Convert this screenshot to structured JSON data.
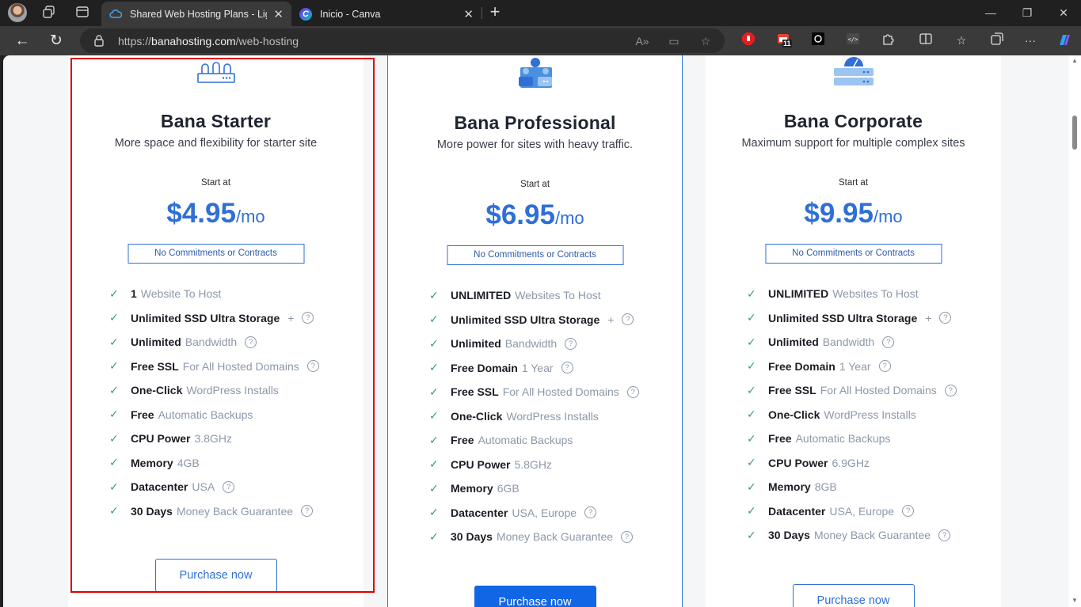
{
  "browser": {
    "tabs": [
      {
        "title": "Shared Web Hosting Plans - Lightning Fast",
        "active": true
      },
      {
        "title": "Inicio - Canva",
        "active": false
      }
    ],
    "url_prefix": "https://",
    "url_host": "banahosting.com",
    "url_path": "/web-hosting",
    "ext_badge": "11"
  },
  "plans": [
    {
      "name": "Bana Starter",
      "desc": "More space and flexibility for starter site",
      "start_label": "Start at",
      "price": "$4.95",
      "per": "/mo",
      "commit": "No Commitments or Contracts",
      "button": "Purchase now",
      "features": [
        {
          "bold": "1",
          "light": "Website To Host",
          "help": false
        },
        {
          "bold": "Unlimited SSD Ultra Storage",
          "light": "+",
          "help": true
        },
        {
          "bold": "Unlimited",
          "light": "Bandwidth",
          "help": true
        },
        {
          "bold": "Free SSL",
          "light": "For All Hosted Domains",
          "help": true
        },
        {
          "bold": "One-Click",
          "light": "WordPress Installs",
          "help": false
        },
        {
          "bold": "Free",
          "light": "Automatic Backups",
          "help": false
        },
        {
          "bold": "CPU Power",
          "light": "3.8GHz",
          "help": false
        },
        {
          "bold": "Memory",
          "light": "4GB",
          "help": false
        },
        {
          "bold": "Datacenter",
          "light": "USA",
          "help": true
        },
        {
          "bold": "30 Days",
          "light": "Money Back Guarantee",
          "help": true
        }
      ]
    },
    {
      "name": "Bana Professional",
      "desc": "More power for sites with heavy traffic.",
      "start_label": "Start at",
      "price": "$6.95",
      "per": "/mo",
      "commit": "No Commitments or Contracts",
      "button": "Purchase now",
      "features": [
        {
          "bold": "UNLIMITED",
          "light": "Websites To Host",
          "help": false
        },
        {
          "bold": "Unlimited SSD Ultra Storage",
          "light": "+",
          "help": true
        },
        {
          "bold": "Unlimited",
          "light": "Bandwidth",
          "help": true
        },
        {
          "bold": "Free Domain",
          "light": "1 Year",
          "help": true
        },
        {
          "bold": "Free SSL",
          "light": "For All Hosted Domains",
          "help": true
        },
        {
          "bold": "One-Click",
          "light": "WordPress Installs",
          "help": false
        },
        {
          "bold": "Free",
          "light": "Automatic Backups",
          "help": false
        },
        {
          "bold": "CPU Power",
          "light": "5.8GHz",
          "help": false
        },
        {
          "bold": "Memory",
          "light": "6GB",
          "help": false
        },
        {
          "bold": "Datacenter",
          "light": "USA, Europe",
          "help": true
        },
        {
          "bold": "30 Days",
          "light": "Money Back Guarantee",
          "help": true
        }
      ]
    },
    {
      "name": "Bana Corporate",
      "desc": "Maximum support for multiple complex sites",
      "start_label": "Start at",
      "price": "$9.95",
      "per": "/mo",
      "commit": "No Commitments or Contracts",
      "button": "Purchase now",
      "features": [
        {
          "bold": "UNLIMITED",
          "light": "Websites To Host",
          "help": false
        },
        {
          "bold": "Unlimited SSD Ultra Storage",
          "light": "+",
          "help": true
        },
        {
          "bold": "Unlimited",
          "light": "Bandwidth",
          "help": true
        },
        {
          "bold": "Free Domain",
          "light": "1 Year",
          "help": true
        },
        {
          "bold": "Free SSL",
          "light": "For All Hosted Domains",
          "help": true
        },
        {
          "bold": "One-Click",
          "light": "WordPress Installs",
          "help": false
        },
        {
          "bold": "Free",
          "light": "Automatic Backups",
          "help": false
        },
        {
          "bold": "CPU Power",
          "light": "6.9GHz",
          "help": false
        },
        {
          "bold": "Memory",
          "light": "8GB",
          "help": false
        },
        {
          "bold": "Datacenter",
          "light": "USA, Europe",
          "help": true
        },
        {
          "bold": "30 Days",
          "light": "Money Back Guarantee",
          "help": true
        }
      ]
    }
  ],
  "colors": {
    "accent": "#2f6fd6",
    "button_fill": "#1166e6",
    "highlight": "#e00000",
    "check": "#3a9a7c"
  }
}
